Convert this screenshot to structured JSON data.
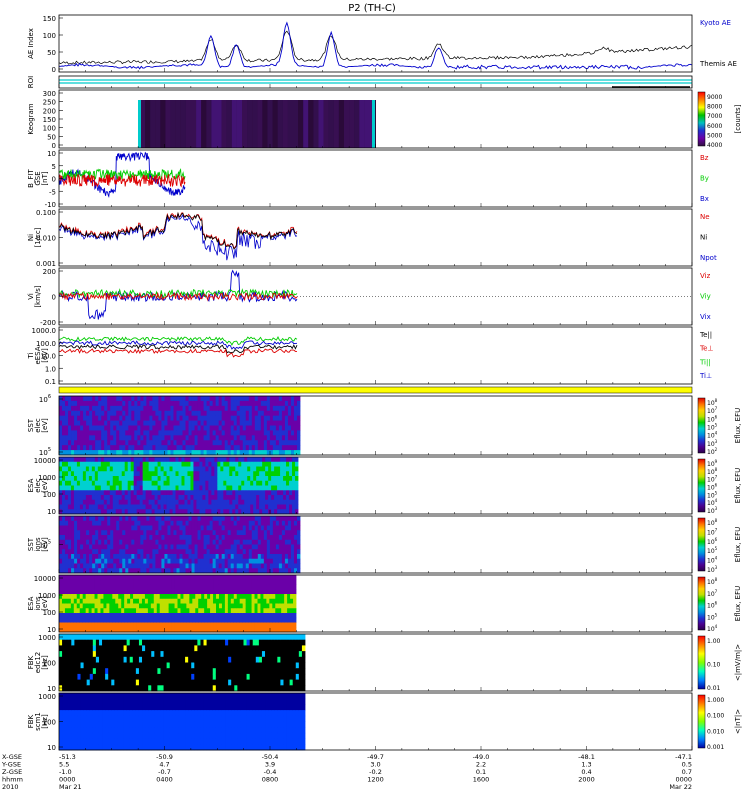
{
  "chart_data": {
    "type": "line",
    "title": "P2 (TH-C)",
    "colors": {
      "blue": "#0000cc",
      "red": "#dd0000",
      "green": "#00cc00",
      "black": "#000000",
      "cyan": "#00cccc",
      "yellow": "#ffff00"
    },
    "panels": [
      {
        "key": "ae",
        "ylabel": "AE Index",
        "yticks": [
          "150",
          "100",
          "50",
          "0"
        ],
        "series": [
          {
            "name": "Kyoto AE",
            "color": "blue"
          },
          {
            "name": "Themis AE",
            "color": "black"
          }
        ]
      },
      {
        "key": "roi",
        "ylabel": "ROI"
      },
      {
        "key": "keogram",
        "ylabel": "Keogram",
        "yticks": [
          "300",
          "250",
          "200",
          "150",
          "100",
          "50",
          "0"
        ],
        "colorbar": {
          "ticks": [
            "9000",
            "8000",
            "7000",
            "6000",
            "5000",
            "4000"
          ],
          "label": "[counts]"
        }
      },
      {
        "key": "bfit",
        "ylabel": "B_FIT",
        "ylabel2": "GSE",
        "units": "[nT]",
        "yticks": [
          "10",
          "5",
          "0",
          "-5",
          "-10"
        ],
        "series": [
          {
            "name": "Bz",
            "color": "red"
          },
          {
            "name": "By",
            "color": "green"
          },
          {
            "name": "Bx",
            "color": "blue"
          }
        ]
      },
      {
        "key": "ni",
        "ylabel": "Ni",
        "units": "[1/cc]",
        "yticks": [
          "0.100",
          "0.010",
          "0.001"
        ],
        "series": [
          {
            "name": "Ne",
            "color": "red"
          },
          {
            "name": "Ni",
            "color": "black"
          },
          {
            "name": "Npot",
            "color": "blue"
          }
        ]
      },
      {
        "key": "vi",
        "ylabel": "Vi",
        "units": "[km/s]",
        "yticks": [
          "200",
          "0",
          "-200"
        ],
        "series": [
          {
            "name": "Viz",
            "color": "red"
          },
          {
            "name": "Viy",
            "color": "green"
          },
          {
            "name": "Vix",
            "color": "blue"
          }
        ]
      },
      {
        "key": "ti",
        "ylabel": "Ti",
        "ylabel2": "eESA",
        "units": "[eV]",
        "yticks": [
          "1000.0",
          "100.0",
          "10.0",
          "1.0",
          "0.1"
        ],
        "series": [
          {
            "name": "Te||",
            "color": "black"
          },
          {
            "name": "Te⊥",
            "color": "red"
          },
          {
            "name": "Ti||",
            "color": "green"
          },
          {
            "name": "Ti⊥",
            "color": "blue"
          }
        ]
      },
      {
        "key": "sst_e",
        "ylabel": "SST",
        "ylabel2": "elec",
        "units": "[eV]",
        "yticks": [
          "10^6",
          "10^5"
        ],
        "colorbar": {
          "ticks": [
            "10^8",
            "10^7",
            "10^6",
            "10^5",
            "10^4",
            "10^3",
            "10^2"
          ],
          "label": "Eflux, EFU"
        }
      },
      {
        "key": "esa_e",
        "ylabel": "ESA",
        "ylabel2": "elec",
        "units": "[eV]",
        "yticks": [
          "10000",
          "1000",
          "100",
          "10"
        ],
        "colorbar": {
          "ticks": [
            "10^9",
            "10^8",
            "10^7",
            "10^6",
            "10^5",
            "10^4",
            "10^3"
          ],
          "label": "Eflux, EFU"
        }
      },
      {
        "key": "sst_i",
        "ylabel": "SST",
        "ylabel2": "ions",
        "units": "[eV]",
        "yticks": [
          "10^5"
        ],
        "colorbar": {
          "ticks": [
            "10^8",
            "10^7",
            "10^6",
            "10^5",
            "10^4",
            "10^3"
          ],
          "label": "Eflux, EFU"
        }
      },
      {
        "key": "esa_i",
        "ylabel": "ESA",
        "ylabel2": "ions",
        "units": "[eV]",
        "yticks": [
          "10000",
          "1000",
          "100",
          "10"
        ],
        "colorbar": {
          "ticks": [
            "10^8",
            "10^7",
            "10^6",
            "10^5",
            "10^4"
          ],
          "label": "Eflux, EFU"
        }
      },
      {
        "key": "fbk_e",
        "ylabel": "FBK",
        "ylabel2": "edc12",
        "units": "[Hz]",
        "yticks": [
          "1000",
          "100",
          "10"
        ],
        "colorbar": {
          "ticks": [
            "1.00",
            "0.10",
            "0.01"
          ],
          "label": "<|mV/m|>"
        }
      },
      {
        "key": "fbk_b",
        "ylabel": "FBK",
        "ylabel2": "scm1",
        "units": "[Hz]",
        "yticks": [
          "1000",
          "100",
          "10"
        ],
        "colorbar": {
          "ticks": [
            "1.000",
            "0.100",
            "0.010",
            "0.001"
          ],
          "label": "<|nT|>"
        }
      }
    ],
    "x_axis": {
      "row_labels": [
        "X-GSE",
        "Y-GSE",
        "Z-GSE",
        "hhmm",
        "2010"
      ],
      "ticks": [
        {
          "x_gse": "-51.3",
          "y_gse": "5.5",
          "z_gse": "-1.0",
          "hhmm": "0000",
          "date": "Mar 21"
        },
        {
          "x_gse": "-50.9",
          "y_gse": "4.7",
          "z_gse": "-0.7",
          "hhmm": "0400",
          "date": ""
        },
        {
          "x_gse": "-50.4",
          "y_gse": "3.9",
          "z_gse": "-0.4",
          "hhmm": "0800",
          "date": ""
        },
        {
          "x_gse": "-49.7",
          "y_gse": "3.0",
          "z_gse": "-0.2",
          "hhmm": "1200",
          "date": ""
        },
        {
          "x_gse": "-49.0",
          "y_gse": "2.2",
          "z_gse": "0.1",
          "hhmm": "1600",
          "date": ""
        },
        {
          "x_gse": "-48.1",
          "y_gse": "1.3",
          "z_gse": "0.4",
          "hhmm": "2000",
          "date": ""
        },
        {
          "x_gse": "-47.1",
          "y_gse": "0.5",
          "z_gse": "0.7",
          "hhmm": "0000",
          "date": "Mar 22"
        }
      ]
    }
  }
}
